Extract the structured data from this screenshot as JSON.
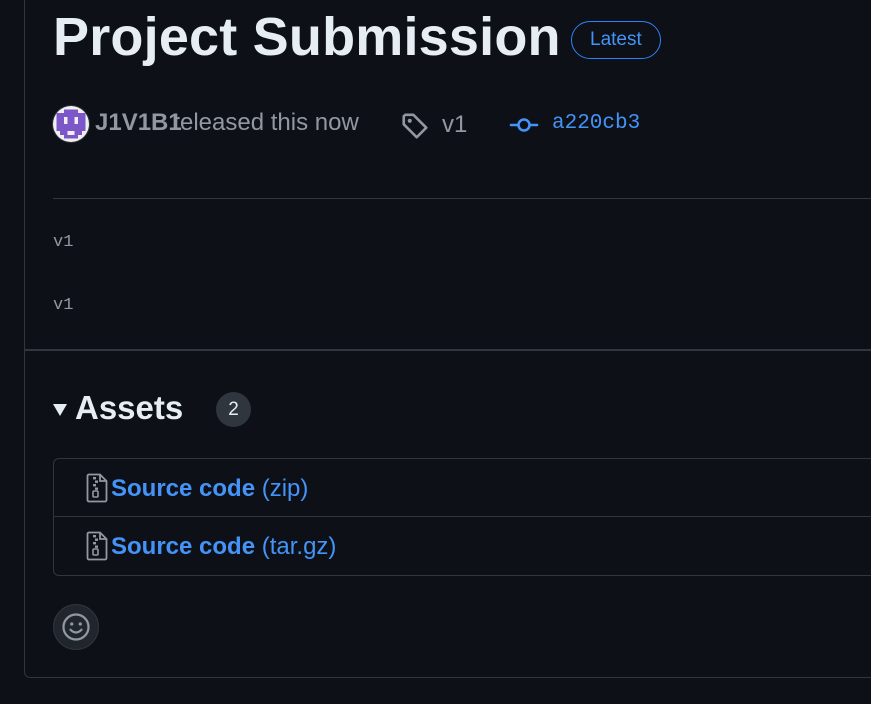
{
  "release": {
    "title": "Project Submission",
    "badge": "Latest",
    "author": "J1V1B1",
    "released_text": "released this now",
    "tag": "v1",
    "commit": "a220cb3",
    "body_lines": [
      "v1",
      "v1"
    ]
  },
  "assets": {
    "title": "Assets",
    "count": "2",
    "items": [
      {
        "name": "Source code",
        "ext": "(zip)"
      },
      {
        "name": "Source code",
        "ext": "(tar.gz)"
      }
    ]
  },
  "icons": {
    "tag": "tag-icon",
    "commit": "git-commit-icon",
    "file_zip": "file-zip-icon",
    "reaction": "smiley-icon"
  },
  "colors": {
    "background": "#0d1117",
    "border": "#30363d",
    "text_primary": "#e6edf3",
    "text_muted": "#9198a1",
    "accent": "#4493f8",
    "avatar_purple": "#7b57c9"
  }
}
